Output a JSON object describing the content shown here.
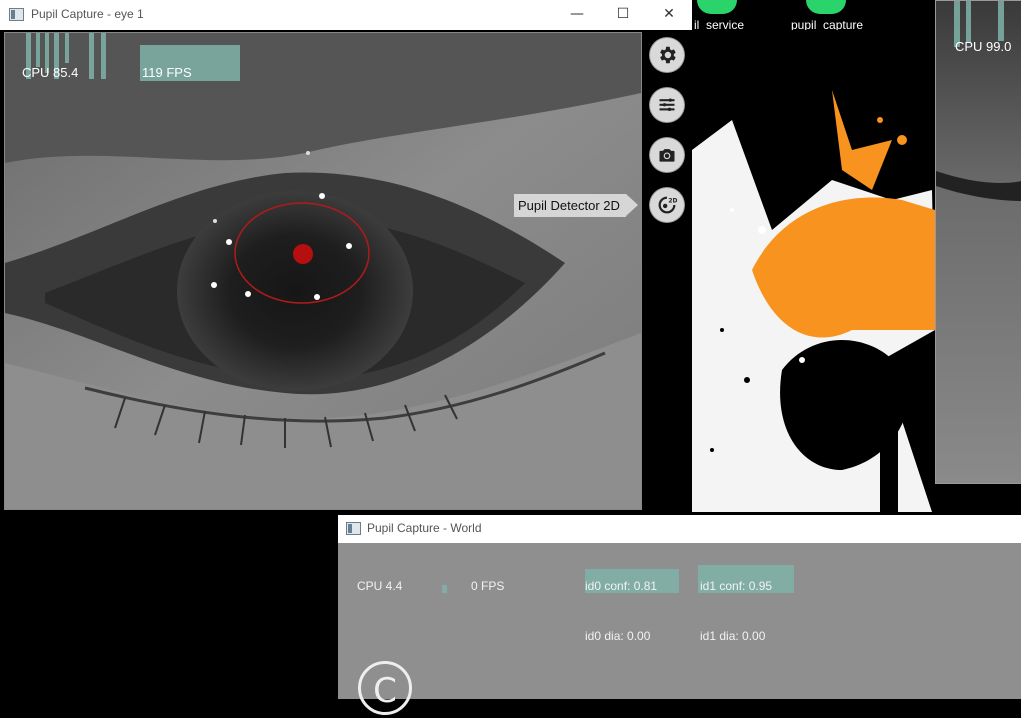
{
  "desktop": {
    "icons": [
      {
        "label": "il_service"
      },
      {
        "label": "pupil_capture"
      }
    ]
  },
  "eye_window": {
    "title": "Pupil Capture - eye 1",
    "window_controls": {
      "minimize": "—",
      "maximize": "☐",
      "close": "✕"
    },
    "cpu": "CPU 85.4",
    "fps": "119 FPS",
    "tooltip": "Pupil Detector 2D",
    "side_buttons": [
      {
        "name": "settings",
        "icon": "gear-icon"
      },
      {
        "name": "menu",
        "icon": "list-icon"
      },
      {
        "name": "capture",
        "icon": "camera-icon"
      },
      {
        "name": "detector-2d",
        "icon": "detector-2d-icon"
      }
    ],
    "detector_badge": "2D"
  },
  "right_window": {
    "cpu": "CPU 99.0"
  },
  "world_window": {
    "title": "Pupil Capture - World",
    "cpu": "CPU 4.4",
    "fps": "0 FPS",
    "id0_conf": "id0 conf: 0.81",
    "id1_conf": "id1 conf: 0.95",
    "id0_dia": "id0 dia: 0.00",
    "id1_dia": "id1 dia: 0.00",
    "logo_letter": "C"
  },
  "colors": {
    "graph": "#7fb3a9",
    "pupil_ellipse": "#b11a1a",
    "splash_orange": "#f7931e"
  }
}
